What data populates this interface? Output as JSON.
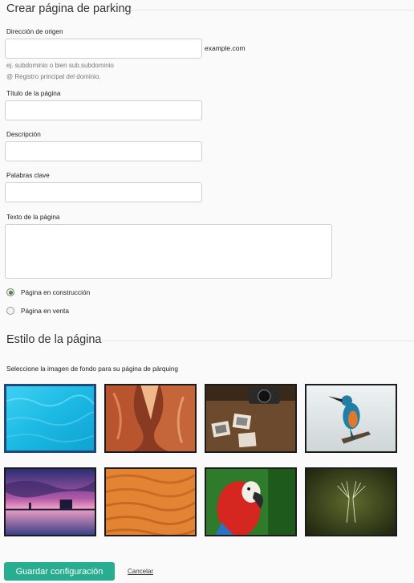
{
  "page_title": "Crear página de parking",
  "source": {
    "label": "Dirección de origen",
    "value": "",
    "suffix": "example.com",
    "hint1": "ej. subdominio o bien sub.subdominio",
    "hint2": "@ Registro principal del dominio."
  },
  "title_field": {
    "label": "Título de la página",
    "value": ""
  },
  "description_field": {
    "label": "Descripción",
    "value": ""
  },
  "keywords_field": {
    "label": "Palabras clave",
    "value": ""
  },
  "text_field": {
    "label": "Texto de la página",
    "value": ""
  },
  "status_options": [
    {
      "label": "Página en construcción",
      "checked": true
    },
    {
      "label": "Página en venta",
      "checked": false
    }
  ],
  "style_section": {
    "title": "Estilo de la página",
    "instruction": "Seleccione la imagen de fondo para su página de párquing",
    "images": [
      {
        "name": "water",
        "selected": true
      },
      {
        "name": "canyon",
        "selected": false
      },
      {
        "name": "cameras-photos",
        "selected": false
      },
      {
        "name": "kingfisher",
        "selected": false
      },
      {
        "name": "sunset-lake",
        "selected": false
      },
      {
        "name": "sand-dunes",
        "selected": false
      },
      {
        "name": "macaw",
        "selected": false
      },
      {
        "name": "dandelion-seeds",
        "selected": false
      }
    ]
  },
  "actions": {
    "save": "Guardar configuración",
    "cancel": "Cancelar"
  },
  "colors": {
    "primary_button": "#27ae91",
    "selected_border": "#1d4a7a"
  }
}
